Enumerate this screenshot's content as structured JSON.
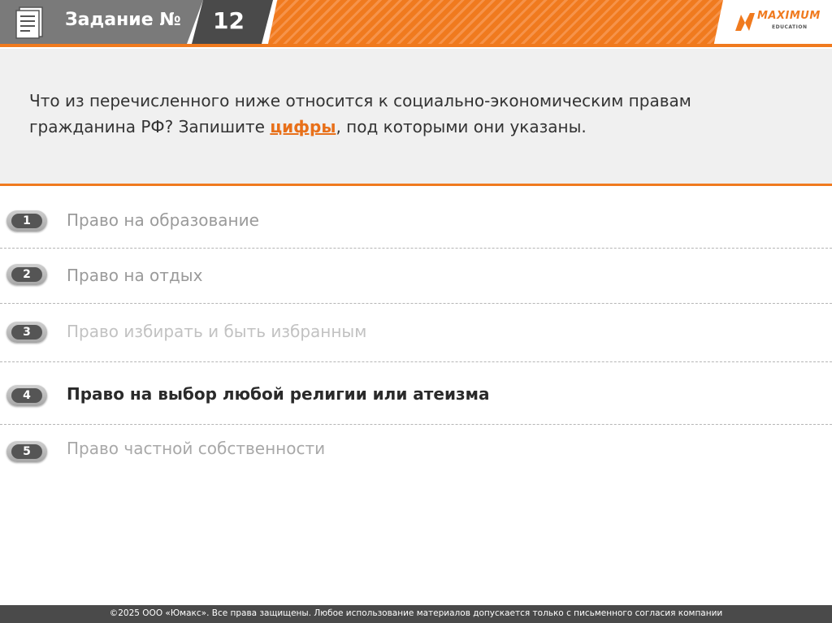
{
  "header": {
    "task_label": "Задание №",
    "task_number": "12",
    "logo_text": "MAXIMUM",
    "logo_sub": "EDUCATION",
    "colors": {
      "accent": "#f07a1e",
      "gray": "#7a7a7a",
      "dark": "#4a4a4a"
    }
  },
  "question": {
    "line1": "Что из перечисленного ниже относится к социально-экономическим правам",
    "line2_before": "гражданина РФ? Запишите ",
    "line2_highlight": "цифры",
    "line2_after": ", под которыми они указаны."
  },
  "options": [
    {
      "number": "1",
      "text": "Право на образование"
    },
    {
      "number": "2",
      "text": "Право на отдых"
    },
    {
      "number": "3",
      "text": "Право избирать и быть избранным"
    },
    {
      "number": "4",
      "text": "Право на выбор любой религии или атеизма"
    },
    {
      "number": "5",
      "text": "Право частной собственности"
    }
  ],
  "footer": {
    "copyright": "©2025 ООО «Юмакс». Все права защищены. Любое использование материалов допускается только с  письменного согласия компании"
  }
}
